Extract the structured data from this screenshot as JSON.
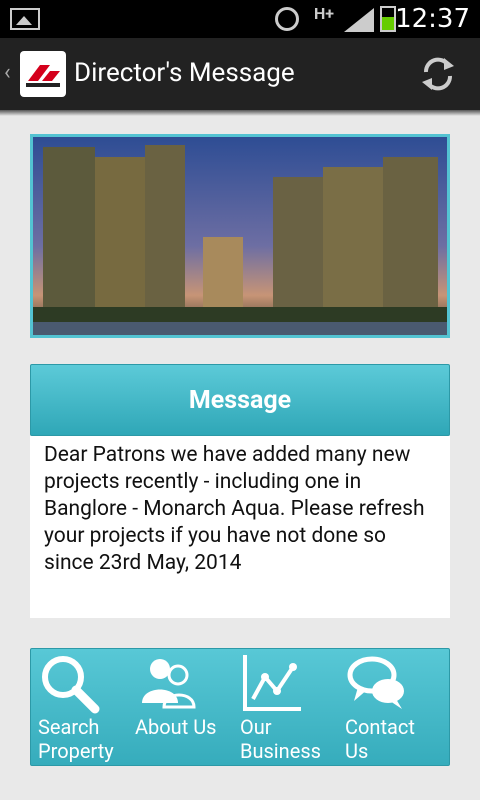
{
  "status_bar": {
    "time": "12:37",
    "network": "H+"
  },
  "action_bar": {
    "title": "Director's Message"
  },
  "message": {
    "header": "Message",
    "body": "Dear Patrons we have added many new projects recently - including one in Banglore - Monarch Aqua. Please refresh your projects if you have not done so since 23rd May, 2014"
  },
  "nav": [
    {
      "label_line1": "Search",
      "label_line2": "Property"
    },
    {
      "label_line1": "About Us",
      "label_line2": ""
    },
    {
      "label_line1": "Our",
      "label_line2": "Business"
    },
    {
      "label_line1": "Contact",
      "label_line2": "Us"
    }
  ],
  "colors": {
    "accent": "#3fb6c6",
    "actionbar": "#222222"
  }
}
